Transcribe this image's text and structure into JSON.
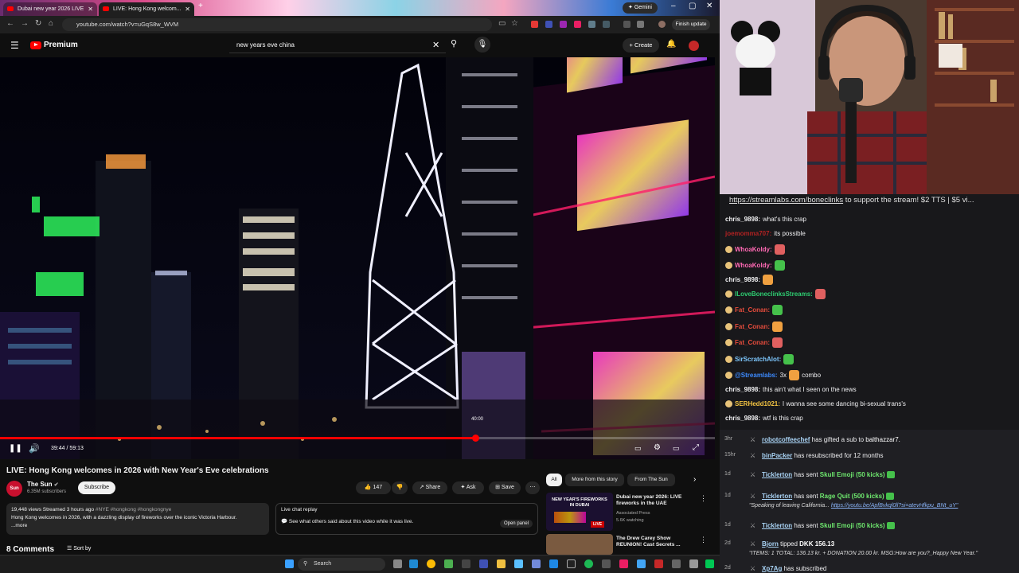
{
  "browser": {
    "tabs": [
      {
        "label": "Dubai new year 2026 LIVE"
      },
      {
        "label": "LIVE: Hong Kong welcom..."
      }
    ],
    "gemini_label": "Gemini",
    "url": "youtube.com/watch?v=uGqS8w_WVM",
    "finish_update_label": "Finish update"
  },
  "youtube_header": {
    "logo_text": "Premium",
    "search_value": "new years eve china",
    "create_label": "Create"
  },
  "player": {
    "time_current": "39:44",
    "time_total": "59:13",
    "hover_time": "40:00",
    "progress_fraction": 0.67
  },
  "video_info": {
    "title": "LIVE: Hong Kong welcomes in 2026 with New Year's Eve celebrations",
    "channel_name": "The Sun",
    "channel_avatar_text": "Sun",
    "subscribers": "6.35M subscribers",
    "subscribe_label": "Subscribe",
    "likes": "147",
    "share_label": "Share",
    "ask_label": "Ask",
    "save_label": "Save",
    "description_stats": "19,448 views  Streamed 3 hours ago",
    "description_tags": "#NYE #hongkong #hongkongnye",
    "description_text": "Hong Kong welcomes in 2026, with a dazzling display of fireworks over the iconic Victoria Harbour.",
    "description_more": "...more",
    "live_chat_title": "Live chat replay",
    "live_chat_text": "See what others said about this video while it was live.",
    "open_panel_label": "Open panel",
    "comments_count": "8 Comments",
    "sort_label": "Sort by"
  },
  "related": {
    "chips": [
      "All",
      "More from this story",
      "From The Sun"
    ],
    "items": [
      {
        "title": "Dubai new year 2026: LIVE fireworks in the UAE",
        "channel": "Associated Press",
        "meta": "5.6K watching",
        "thumb_text": "NEW YEAR'S FIREWORKS IN DUBAI",
        "live_badge": "LIVE"
      },
      {
        "title": "The Drew Carey Show REUNION! Cast Secrets ...",
        "channel": "",
        "meta": "",
        "thumb_text": "",
        "live_badge": ""
      }
    ]
  },
  "taskbar": {
    "search_label": "Search"
  },
  "chat": {
    "tts_link": "https://streamlabs.com/boneclinks",
    "tts_text": "to support the stream! $2 TTS | $5 vi...",
    "messages": [
      {
        "user": "chris_9898",
        "text": "what's this crap",
        "color": "#efeff1"
      },
      {
        "user": "joemomma707",
        "text": "its possible",
        "color": "#b22222"
      },
      {
        "user": "WhoaKoldy",
        "text": "",
        "color": "#ff69b4"
      },
      {
        "user": "WhoaKoldy",
        "text": "",
        "color": "#ff69b4"
      },
      {
        "user": "chris_9898",
        "text": "",
        "color": "#efeff1"
      },
      {
        "user": "ILoveBoneclinksStreams",
        "text": "",
        "color": "#2ecc71"
      },
      {
        "user": "Fat_Conan",
        "text": "",
        "color": "#e74c3c"
      },
      {
        "user": "Fat_Conan",
        "text": "",
        "color": "#e74c3c"
      },
      {
        "user": "Fat_Conan",
        "text": "",
        "color": "#e74c3c"
      },
      {
        "user": "SirScratchAlot",
        "text": "",
        "color": "#7ec8ff"
      },
      {
        "user": "@Streamlabs",
        "text": "3x",
        "text2": "combo",
        "color": "#3d8bff"
      },
      {
        "user": "chris_9898",
        "text": "this ain't what I seen on the news",
        "color": "#efeff1"
      },
      {
        "user": "SERHedd1021",
        "text": "I wanna see some dancing bi-sexual trans's",
        "color": "#f5c542"
      },
      {
        "user": "chris_9898",
        "text": "wtf is this crap",
        "color": "#efeff1"
      }
    ]
  },
  "feed": {
    "items": [
      {
        "time": "3hr",
        "user": "robotcoffeechef",
        "text": "has gifted a sub to",
        "extra": "balthazzar7."
      },
      {
        "time": "15hr",
        "user": "binPacker",
        "text": "has resubscribed for 12 months",
        "extra": ""
      },
      {
        "time": "1d",
        "user": "Ticklerton",
        "text": "has sent",
        "extra": "Skull Emoji (50 kicks)"
      },
      {
        "time": "1d",
        "user": "Ticklerton",
        "text": "has sent",
        "extra": "Rage Quit (500 kicks)",
        "sub": "\"Speaking of leaving California...",
        "sub_link": "https://youtu.be/ApfBvkql0ll?si=atevHfkpu_BNt_uY\""
      },
      {
        "time": "1d",
        "user": "Ticklerton",
        "text": "has sent",
        "extra": "Skull Emoji (50 kicks)"
      },
      {
        "time": "2d",
        "user": "Bjorn",
        "text": "tipped",
        "extra": "DKK 156.13",
        "sub": "\"ITEMS: 1 TOTAL: 136.13 kr. + DONATION 20.00 kr. MSG:How are you?_Happy New Year.\""
      },
      {
        "time": "2d",
        "user": "Xp7Ag",
        "text": "has subscribed",
        "extra": ""
      }
    ]
  },
  "colors": {
    "youtube_red": "#ff0000",
    "chat_bg": "#18181b",
    "feed_bg": "#1f1f23",
    "emote_green": "#45c14b"
  }
}
